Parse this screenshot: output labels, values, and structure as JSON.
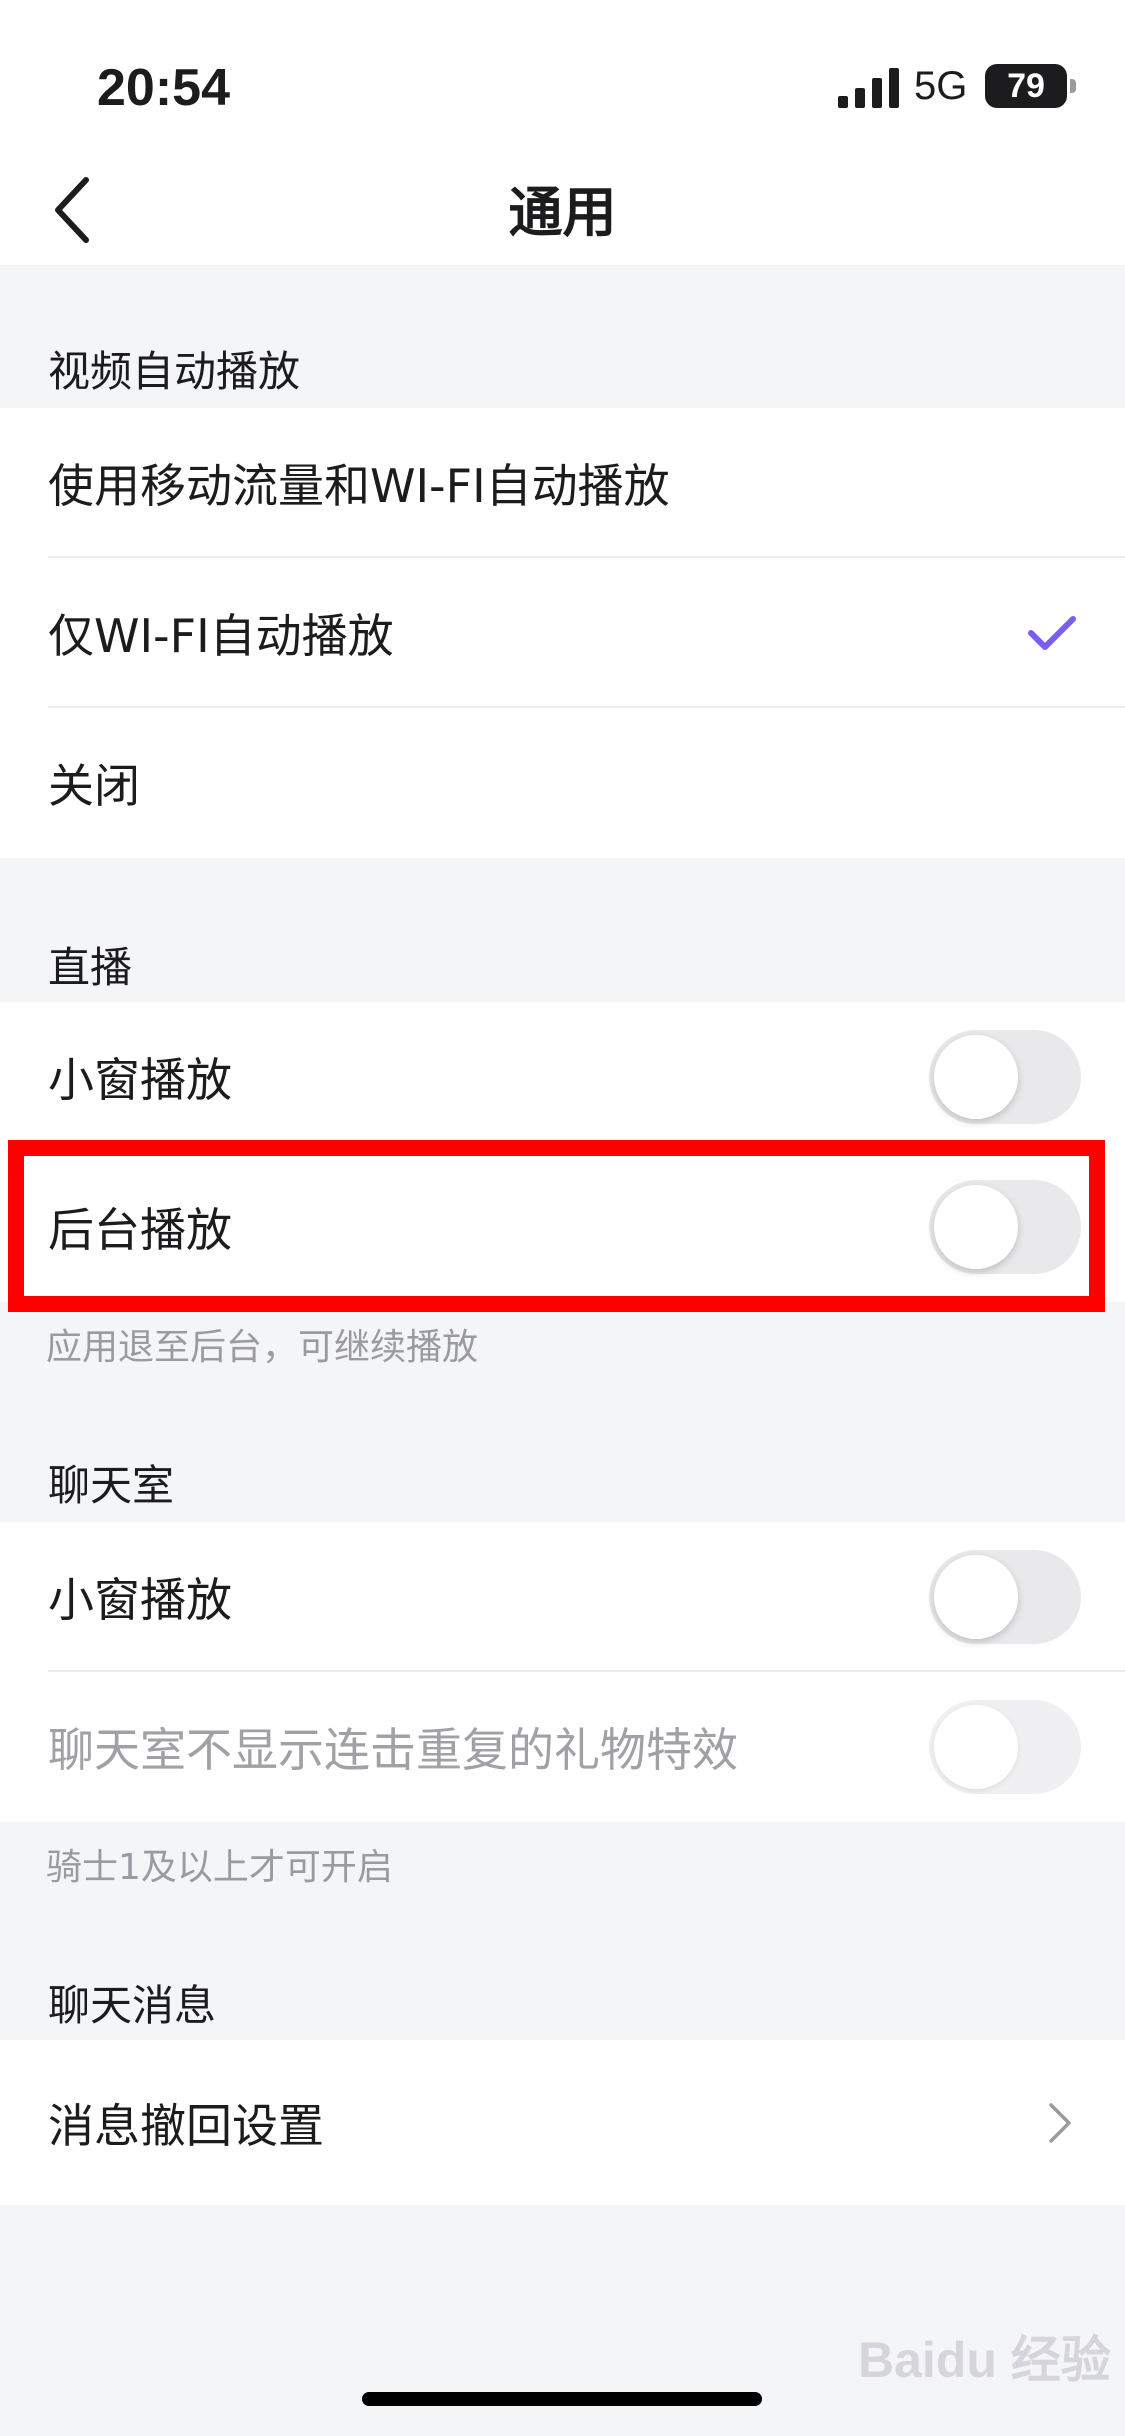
{
  "status_bar": {
    "time": "20:54",
    "network": "5G",
    "battery": "79"
  },
  "nav": {
    "title": "通用"
  },
  "sections": {
    "autoplay": {
      "header": "视频自动播放",
      "options": [
        {
          "label": "使用移动流量和WI-FI自动播放",
          "selected": false
        },
        {
          "label": "仅WI-FI自动播放",
          "selected": true
        },
        {
          "label": "关闭",
          "selected": false
        }
      ]
    },
    "live": {
      "header": "直播",
      "rows": [
        {
          "label": "小窗播放",
          "enabled": false
        },
        {
          "label": "后台播放",
          "enabled": false
        }
      ],
      "footnote": "应用退至后台，可继续播放"
    },
    "chatroom": {
      "header": "聊天室",
      "rows": [
        {
          "label": "小窗播放",
          "enabled": false
        },
        {
          "label": "聊天室不显示连击重复的礼物特效",
          "enabled": false,
          "disabled": true
        }
      ],
      "footnote": "骑士1及以上才可开启"
    },
    "messages": {
      "header": "聊天消息",
      "rows": [
        {
          "label": "消息撤回设置"
        }
      ]
    }
  },
  "accent_color": "#7b5cf5",
  "highlight_color": "#ff0000",
  "watermark": "Baidu 经验"
}
